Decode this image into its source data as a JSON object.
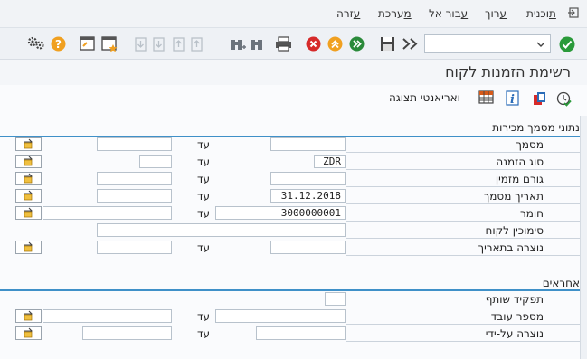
{
  "menubar": {
    "items": [
      "תוכנית",
      "ערוך",
      "עבור אל",
      "מערכת",
      "עזרה"
    ]
  },
  "toolbar": {
    "command_field": "",
    "command_field_dropdown": "chevron-down"
  },
  "page": {
    "title": "רשימת הזמנות לקוח"
  },
  "app_toolbar": {
    "variants_label": "ואריאנטי תצוגה"
  },
  "groups": {
    "sales_data": {
      "header": "נתוני מסמך מכירות",
      "to_label": "עד",
      "rows": [
        {
          "label": "מסמך",
          "from": "",
          "to": ""
        },
        {
          "label": "סוג הזמנה",
          "from": "ZDR",
          "to": ""
        },
        {
          "label": "גורם מזמין",
          "from": "",
          "to": ""
        },
        {
          "label": "תאריך מסמך",
          "from": "31.12.2018",
          "to": ""
        },
        {
          "label": "חומר",
          "from": "3000000001",
          "to": ""
        },
        {
          "label": "סימוכין לקוח",
          "from": ""
        },
        {
          "label": "נוצרה בתאריך",
          "from": "",
          "to": ""
        }
      ]
    },
    "responsible": {
      "header": "אחראים",
      "to_label": "עד",
      "rows": [
        {
          "label": "תפקיד שותף",
          "from": ""
        },
        {
          "label": "מספר עובד",
          "from": "",
          "to": ""
        },
        {
          "label": "נוצרה על-ידי",
          "from": "",
          "to": ""
        }
      ]
    }
  },
  "colors": {
    "ok_green": "#2a9a3a",
    "cancel_red": "#d62a2a",
    "exit_orange": "#f0a020",
    "back_green": "#2a8a3a",
    "group_line": "#3f90c8"
  }
}
